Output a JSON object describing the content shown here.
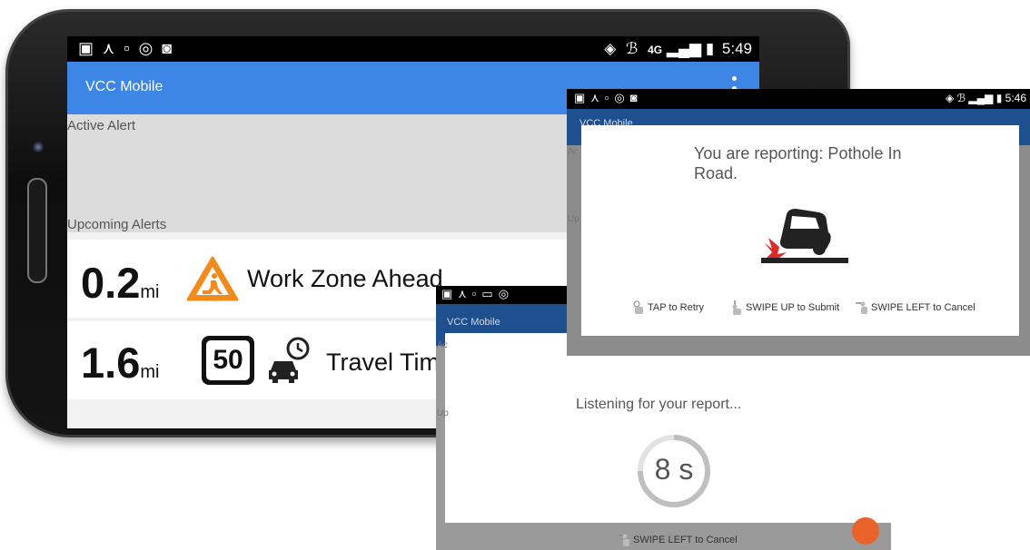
{
  "main": {
    "status_time": "5:49",
    "network": "4G",
    "app_title": "VCC Mobile",
    "active_alert_label": "Active Alert",
    "upcoming_alerts_label": "Upcoming Alerts",
    "alerts": [
      {
        "distance": "0.2",
        "unit": "mi",
        "icon": "work-zone-icon",
        "text": "Work Zone Ahead"
      },
      {
        "distance": "1.6",
        "unit": "mi",
        "icon": "speed-limit-sign-icon",
        "sign_value": "50",
        "text": "Travel Tim"
      }
    ]
  },
  "listening_overlay": {
    "app_title": "VCC Mobile",
    "message": "Listening for your report...",
    "timer": "8 s",
    "cancel_hint": "SWIPE LEFT to Cancel"
  },
  "report_overlay": {
    "status_time": "5:46",
    "app_title": "VCC Mobile",
    "message": "You are reporting: Pothole In Road.",
    "hints": {
      "retry": "TAP to Retry",
      "submit": "SWIPE UP to Submit",
      "cancel": "SWIPE LEFT to Cancel"
    }
  },
  "colors": {
    "appbar": "#3d86e6",
    "appbar_dark": "#1e4f8e",
    "warning_orange": "#f28a1c",
    "pothole_red": "#d92b2b"
  }
}
